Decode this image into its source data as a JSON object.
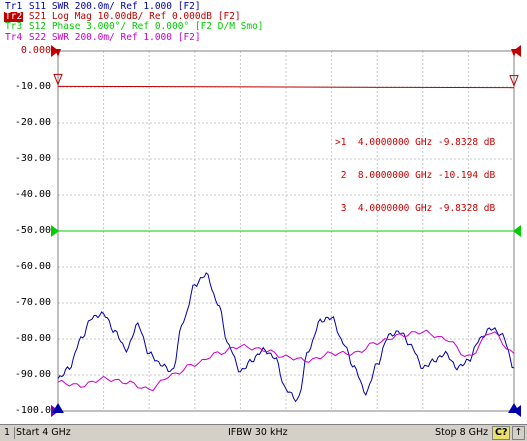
{
  "traces": [
    {
      "id": "Tr1",
      "label": "S11",
      "format": "SWR",
      "scale": "200.0m/",
      "ref": "Ref 1.000",
      "extra": "[F2]",
      "color": "#0000aa",
      "active": false
    },
    {
      "id": "Tr2",
      "label": "S21",
      "format": "Log Mag",
      "scale": "10.00dB/",
      "ref": "Ref 0.000dB",
      "extra": "[F2]",
      "color": "#c00000",
      "active": true
    },
    {
      "id": "Tr3",
      "label": "S12",
      "format": "Phase",
      "scale": "3.000°/",
      "ref": "Ref 0.000°",
      "extra": "[F2 D/M Smo]",
      "color": "#00cc00",
      "active": false
    },
    {
      "id": "Tr4",
      "label": "S22",
      "format": "SWR",
      "scale": "200.0m/",
      "ref": "Ref 1.000",
      "extra": "[F2]",
      "color": "#cc00cc",
      "active": false
    }
  ],
  "y_axis_labels": [
    "0.000",
    "-10.00",
    "-20.00",
    "-30.00",
    "-40.00",
    "-50.00",
    "-60.00",
    "-70.00",
    "-80.00",
    "-90.00",
    "-100.0"
  ],
  "markers": [
    {
      "prefix": ">1",
      "freq": "4.0000000 GHz",
      "value": "-9.8328 dB"
    },
    {
      "prefix": " 2",
      "freq": "8.0000000 GHz",
      "value": "-10.194 dB"
    },
    {
      "prefix": " 3",
      "freq": "4.0000000 GHz",
      "value": "-9.8328 dB"
    }
  ],
  "status": {
    "channel": "1",
    "start": "Start 4 GHz",
    "ifbw": "IFBW 30 kHz",
    "stop": "Stop 8 GHz",
    "cal": "C?",
    "arrow": "↑"
  },
  "chart_data": {
    "type": "line",
    "title": "",
    "xlabel": "",
    "ylabel": "",
    "xlim": [
      4,
      8
    ],
    "ylim": [
      -100,
      0
    ],
    "grid": true,
    "series": [
      {
        "name": "Tr2 S21",
        "color": "#c00000",
        "x": [
          4,
          5,
          6,
          7,
          8
        ],
        "values": [
          -9.83,
          -9.9,
          -10.0,
          -10.1,
          -10.19
        ]
      },
      {
        "name": "Tr3 S12",
        "color": "#00cc00",
        "x": [
          4,
          6,
          8
        ],
        "values": [
          -50,
          -50,
          -50
        ]
      },
      {
        "name": "Tr1 S11",
        "color": "#0000aa",
        "x": [
          4.0,
          4.1,
          4.2,
          4.3,
          4.4,
          4.5,
          4.6,
          4.7,
          4.8,
          4.9,
          5.0,
          5.1,
          5.2,
          5.3,
          5.4,
          5.5,
          5.6,
          5.7,
          5.8,
          5.9,
          6.0,
          6.1,
          6.2,
          6.3,
          6.4,
          6.5,
          6.6,
          6.7,
          6.8,
          6.9,
          7.0,
          7.1,
          7.2,
          7.3,
          7.4,
          7.5,
          7.6,
          7.7,
          7.8,
          7.9,
          8.0
        ],
        "values": [
          -91,
          -88,
          -80,
          -74,
          -73,
          -78,
          -83,
          -76,
          -84,
          -87,
          -89,
          -75,
          -65,
          -62,
          -70,
          -82,
          -89,
          -86,
          -83,
          -85,
          -94,
          -97,
          -83,
          -75,
          -74,
          -81,
          -88,
          -95,
          -87,
          -79,
          -78,
          -82,
          -88,
          -86,
          -84,
          -88,
          -86,
          -80,
          -77,
          -79,
          -88
        ]
      },
      {
        "name": "Tr4 S22",
        "color": "#cc00cc",
        "x": [
          4.0,
          4.2,
          4.4,
          4.6,
          4.8,
          5.0,
          5.2,
          5.4,
          5.6,
          5.8,
          6.0,
          6.2,
          6.4,
          6.6,
          6.8,
          7.0,
          7.2,
          7.4,
          7.6,
          7.8,
          8.0
        ],
        "values": [
          -92,
          -93,
          -91,
          -92,
          -94,
          -90,
          -87,
          -84,
          -82,
          -83,
          -85,
          -86,
          -84,
          -84,
          -81,
          -79,
          -78,
          -80,
          -85,
          -78,
          -84
        ]
      }
    ]
  }
}
